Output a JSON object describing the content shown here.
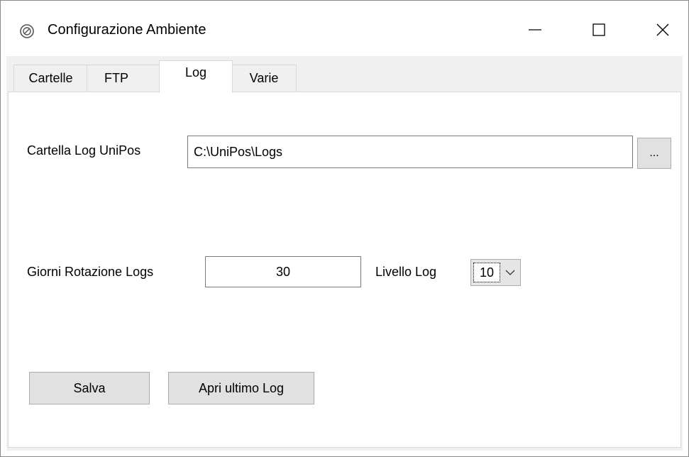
{
  "window": {
    "title": "Configurazione Ambiente",
    "icon": "settings-gauge-icon"
  },
  "tabs": [
    {
      "label": "Cartelle",
      "active": false
    },
    {
      "label": "FTP",
      "active": false
    },
    {
      "label": "Log",
      "active": true
    },
    {
      "label": "Varie",
      "active": false
    }
  ],
  "log_tab": {
    "folder_label": "Cartella Log UniPos",
    "folder_value": "C:\\UniPos\\Logs",
    "browse_label": "...",
    "rotation_label": "Giorni Rotazione Logs",
    "rotation_value": "30",
    "level_label": "Livello Log",
    "level_value": "10"
  },
  "buttons": {
    "save_label": "Salva",
    "open_last_log_label": "Apri ultimo Log"
  }
}
